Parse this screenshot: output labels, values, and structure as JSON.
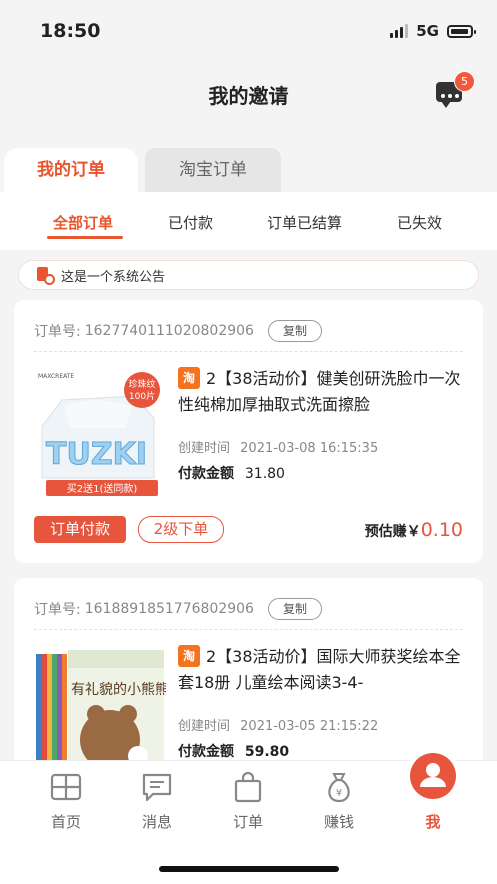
{
  "status": {
    "time": "18:50",
    "network": "5G"
  },
  "header": {
    "title": "我的邀请",
    "message_badge": "5"
  },
  "main_tabs": [
    {
      "label": "我的订单",
      "active": true
    },
    {
      "label": "淘宝订单",
      "active": false
    }
  ],
  "filters": [
    {
      "label": "全部订单",
      "active": true
    },
    {
      "label": "已付款",
      "active": false
    },
    {
      "label": "订单已结算",
      "active": false
    },
    {
      "label": "已失效",
      "active": false
    }
  ],
  "notice": {
    "text": "这是一个系统公告"
  },
  "orders": [
    {
      "order_label": "订单号:",
      "order_no": "1627740111020802906",
      "copy_label": "复制",
      "platform_badge": "淘",
      "title": "2【38活动价】健美创研洗脸巾一次性纯棉加厚抽取式洗面擦脸",
      "created_label": "创建时间",
      "created_time": "2021-03-08 16:15:35",
      "amount_label": "付款金额",
      "amount": "31.80",
      "thumb": {
        "brand": "MAXCREATE",
        "product_text": "TUZKI",
        "badge": "珍珠纹\n100片",
        "promo": "买2送1(送同款)"
      },
      "tag_primary": "订单付款",
      "tag_secondary": "2级下单",
      "earn_label": "预估赚￥",
      "earn_value": "0.10"
    },
    {
      "order_label": "订单号:",
      "order_no": "1618891851776802906",
      "copy_label": "复制",
      "platform_badge": "淘",
      "title": "2【38活动价】国际大师获奖绘本全套18册 儿童绘本阅读3-4-",
      "created_label": "创建时间",
      "created_time": "2021-03-05 21:15:22",
      "amount_label": "付款金额",
      "amount": "59.80",
      "thumb": {
        "book_title": "有礼貌的小熊熊"
      }
    }
  ],
  "tabbar": [
    {
      "label": "首页",
      "icon": "home-grid-icon",
      "active": false
    },
    {
      "label": "消息",
      "icon": "message-icon",
      "active": false
    },
    {
      "label": "订单",
      "icon": "bag-icon",
      "active": false
    },
    {
      "label": "赚钱",
      "icon": "money-bag-icon",
      "active": false
    },
    {
      "label": "我",
      "icon": "user-icon",
      "active": true
    }
  ],
  "colors": {
    "accent": "#e8553d",
    "taobao": "#f3731f",
    "background": "#f4f4f4"
  }
}
